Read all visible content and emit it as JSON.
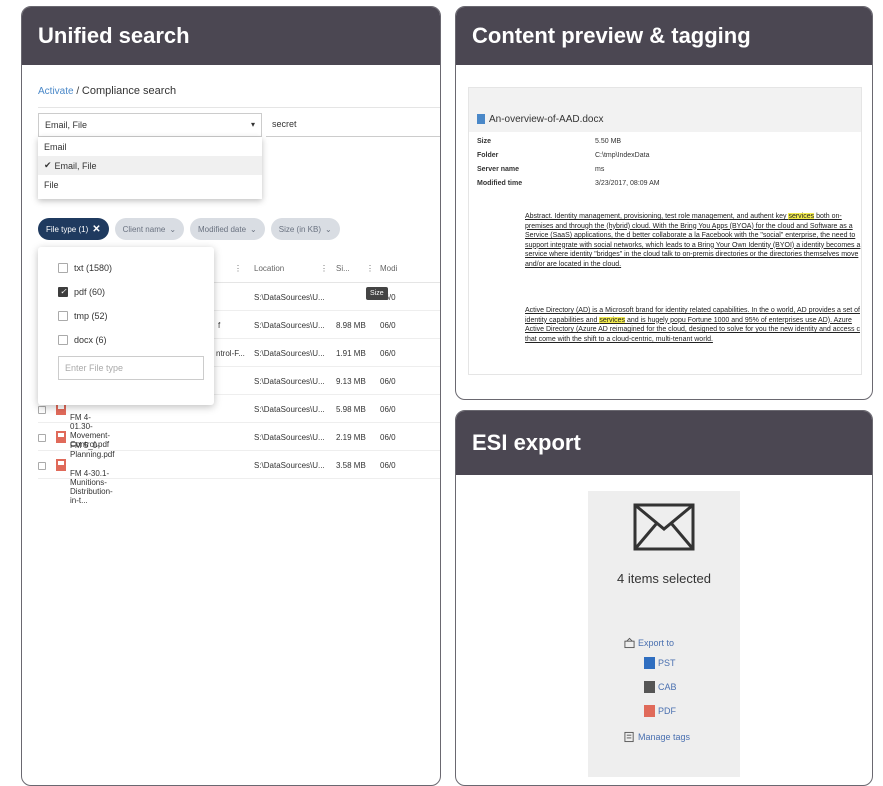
{
  "panels": {
    "unified": {
      "title": "Unified search"
    },
    "preview": {
      "title": "Content preview & tagging"
    },
    "esi": {
      "title": "ESI export"
    }
  },
  "search": {
    "breadcrumb_link": "Activate",
    "breadcrumb_sep": "/",
    "breadcrumb_current": "Compliance search",
    "scope_value": "Email, File",
    "scope_options": [
      "Email",
      "Email, File",
      "File"
    ],
    "query": "secret"
  },
  "filters": {
    "chips": [
      "File type (1)",
      "Client name",
      "Modified date",
      "Size (in KB)"
    ],
    "file_types": [
      {
        "label": "txt (1580)",
        "checked": false
      },
      {
        "label": "pdf (60)",
        "checked": true
      },
      {
        "label": "tmp (52)",
        "checked": false
      },
      {
        "label": "docx (6)",
        "checked": false
      }
    ],
    "file_type_placeholder": "Enter File type"
  },
  "table": {
    "columns": [
      "Location",
      "Si...",
      "Modi"
    ],
    "tooltip": "Size",
    "rows": [
      {
        "name": "",
        "location": "S:\\DataSources\\U...",
        "size": "",
        "mod": "06/0"
      },
      {
        "name": "f",
        "location": "S:\\DataSources\\U...",
        "size": "8.98 MB",
        "mod": "06/0"
      },
      {
        "name": "ntrol-F...",
        "location": "S:\\DataSources\\U...",
        "size": "1.91 MB",
        "mod": "06/0"
      },
      {
        "name": "",
        "location": "S:\\DataSources\\U...",
        "size": "9.13 MB",
        "mod": "06/0"
      },
      {
        "name": "FM 4-01.30-Movement-Control.pdf",
        "location": "S:\\DataSources\\U...",
        "size": "5.98 MB",
        "mod": "06/0"
      },
      {
        "name": "FM 5_0-Planning.pdf",
        "location": "S:\\DataSources\\U...",
        "size": "2.19 MB",
        "mod": "06/0"
      },
      {
        "name": "FM 4-30.1-Munitions-Distribution-in-t...",
        "location": "S:\\DataSources\\U...",
        "size": "3.58 MB",
        "mod": "06/0"
      }
    ]
  },
  "preview": {
    "file_name": "An-overview-of-AAD.docx",
    "props": [
      {
        "k": "Size",
        "v": "5.50 MB"
      },
      {
        "k": "Folder",
        "v": "C:\\tmp\\IndexData"
      },
      {
        "k": "Server name",
        "v": "ms"
      },
      {
        "k": "Modified time",
        "v": "3/23/2017, 08:09 AM"
      }
    ],
    "para1_a": "Abstract. Identity management, provisioning, test role management, and authent key ",
    "para1_hl": "services",
    "para1_b": " both on-premises and through the (hybrid) cloud. With the Bring You Apps (BYOA) for the cloud and Software as a Service (SaaS) applications, the d better collaborate a la Facebook with the \"social\" enterprise, the need to support integrate with social networks, which leads to a Bring Your Own Identity (BYOI) a identity becomes a service where identity \"bridges\" in the cloud talk to on-premis directories or the directories themselves move and/or are located in the cloud.",
    "para2_a": "Active Directory (AD) is a Microsoft brand for identity related capabilities. In the o world, AD provides a set of identity capabilities and ",
    "para2_hl": "services",
    "para2_b": " and is hugely popu Fortune 1000 and 95% of enterprises use AD). Azure Active Directory (Azure AD reimagined for the cloud, designed to solve for you the new identity and access c that come with the shift to a cloud-centric, multi-tenant world."
  },
  "esi": {
    "count_label": "4 items selected",
    "export_to": "Export to",
    "pst": "PST",
    "cab": "CAB",
    "pdf": "PDF",
    "manage_tags": "Manage tags"
  }
}
